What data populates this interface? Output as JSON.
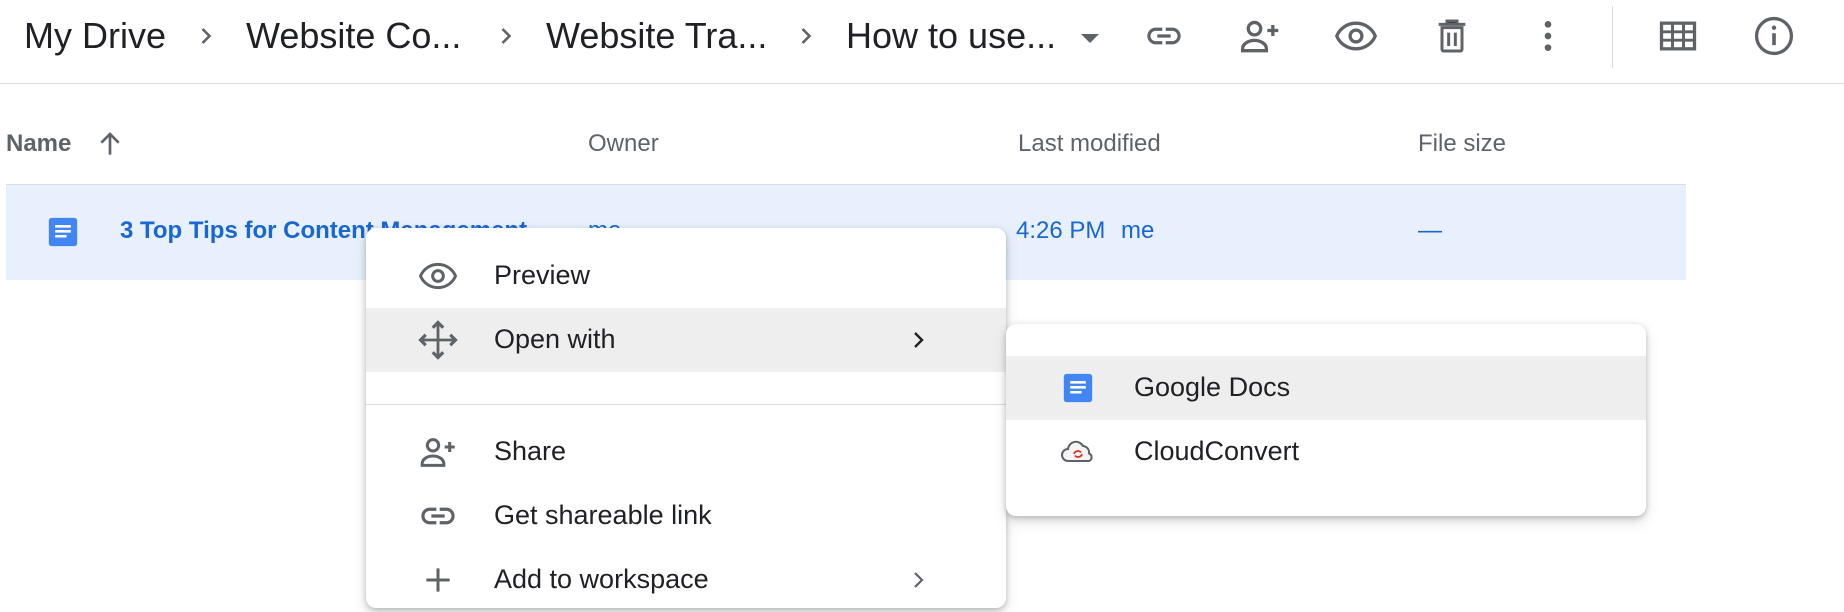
{
  "breadcrumb": {
    "items": [
      "My Drive",
      "Website Co...",
      "Website Tra...",
      "How to use..."
    ]
  },
  "toolbar": {
    "icons": [
      "link-icon",
      "add-person-icon",
      "eye-icon",
      "trash-icon",
      "more-vert-icon",
      "grid-view-icon",
      "info-icon"
    ]
  },
  "table": {
    "headers": {
      "name": "Name",
      "owner": "Owner",
      "modified": "Last modified",
      "size": "File size"
    },
    "sort": "ascending",
    "rows": [
      {
        "name": "3 Top Tips for Content Management",
        "owner": "me",
        "modified": "4:26 PM",
        "modified_by": "me",
        "size": "—",
        "icon": "google-docs-icon"
      }
    ]
  },
  "context_menu": {
    "items": [
      {
        "label": "Preview",
        "icon": "eye-icon"
      },
      {
        "label": "Open with",
        "icon": "move-icon",
        "submenu": true,
        "highlighted": true
      },
      {
        "label": "Share",
        "icon": "add-person-icon"
      },
      {
        "label": "Get shareable link",
        "icon": "link-icon"
      },
      {
        "label": "Add to workspace",
        "icon": "plus-icon",
        "submenu": true
      }
    ]
  },
  "open_with_menu": {
    "items": [
      {
        "label": "Google Docs",
        "icon": "google-docs-icon",
        "highlighted": true
      },
      {
        "label": "CloudConvert",
        "icon": "cloudconvert-icon"
      }
    ]
  },
  "colors": {
    "selection": "#e8f0fe",
    "link_blue": "#1967d2",
    "docs_blue": "#4285f4",
    "icon_gray": "#5f6368"
  }
}
